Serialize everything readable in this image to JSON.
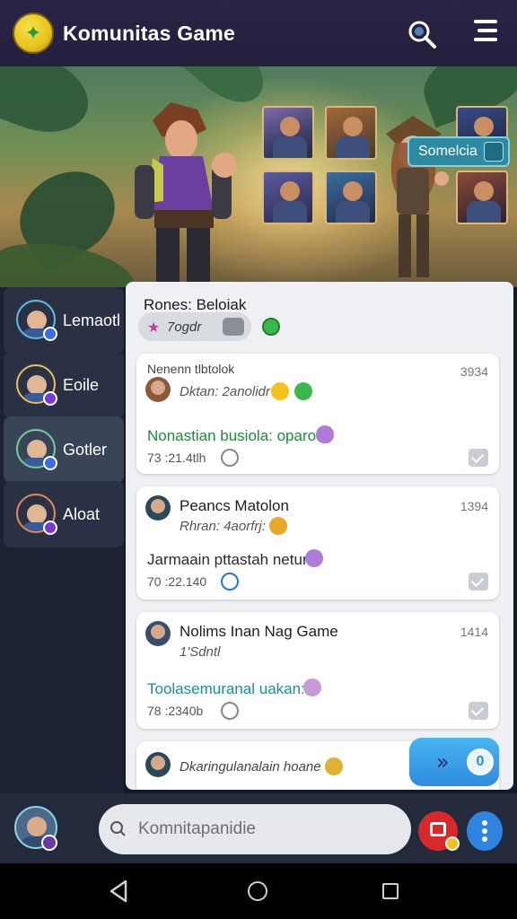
{
  "header": {
    "title": "Komunitas Game",
    "logo_icon": "gamepad-logo-icon",
    "search_icon": "search-icon",
    "menu_icon": "menu-icon"
  },
  "banner": {
    "button_label": "Somelcia"
  },
  "sidebar": {
    "items": [
      {
        "label": "Lemaotl"
      },
      {
        "label": "Eoile"
      },
      {
        "label": "Gotler"
      },
      {
        "label": "Aloat"
      }
    ]
  },
  "panel": {
    "title": "Rones: Beloiak",
    "chip_text": "7ogdr"
  },
  "posts": [
    {
      "name": "Nenenn tlbtolok",
      "time": "3934",
      "sub": "Dktan: 2anolidr",
      "message": "Nonastian busiola: oparot:",
      "message_color": "#1f8a3a",
      "stamp": "73 :21.4tlh"
    },
    {
      "name": "Peancs Matolon",
      "time": "1394",
      "sub": "Rhran: 4aorfrj:",
      "message": "Jarmaain pttastah netun:",
      "message_color": "#2a2a2a",
      "stamp": "70 :22.140"
    },
    {
      "name": "Nolims Inan Nag Game",
      "time": "1414",
      "sub": "1'Sdntl",
      "message": "Toolasemuranal uakan:",
      "message_color": "#1f8a9a",
      "stamp": "78 :2340b"
    },
    {
      "name": "Dkaringulanalain hoane",
      "time": "",
      "sub": "",
      "message": "",
      "message_color": "#2a2a2a",
      "stamp": ""
    }
  ],
  "send_button": {
    "count": "0"
  },
  "composer": {
    "placeholder": "Komnitapanidie"
  },
  "colors": {
    "header_bg": "#2a2446",
    "accent_blue": "#2f8be0",
    "alert_red": "#d8282a"
  }
}
